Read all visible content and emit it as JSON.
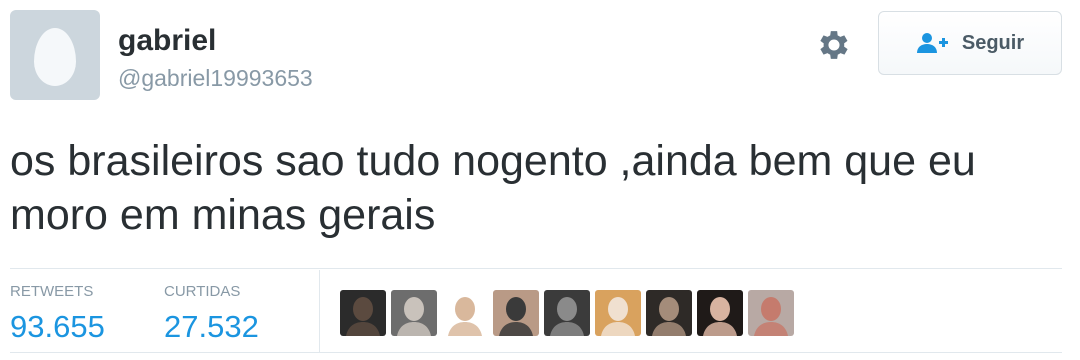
{
  "user": {
    "display_name": "gabriel",
    "handle": "@gabriel19993653",
    "avatar_icon": "egg-icon"
  },
  "actions": {
    "settings_icon": "gear-icon",
    "follow_label": "Seguir",
    "follow_icon": "add-user-icon"
  },
  "tweet": {
    "text": "os brasileiros sao tudo nogento ,ainda bem que eu moro em minas gerais"
  },
  "stats": {
    "retweets_label": "RETWEETS",
    "retweets_value": "93.655",
    "likes_label": "CURTIDAS",
    "likes_value": "27.532"
  },
  "likers": [
    {
      "name": "liker-1",
      "colors": [
        "#2b2b2b",
        "#5b4a3f"
      ]
    },
    {
      "name": "liker-2",
      "colors": [
        "#6d6d6d",
        "#c9c2bb"
      ]
    },
    {
      "name": "liker-3",
      "colors": [
        "#ffffff",
        "#d9b89c"
      ]
    },
    {
      "name": "liker-4",
      "colors": [
        "#b99a86",
        "#3a3a3a"
      ]
    },
    {
      "name": "liker-5",
      "colors": [
        "#3b3b3b",
        "#8a8a8a"
      ]
    },
    {
      "name": "liker-6",
      "colors": [
        "#d9a25e",
        "#f0e0d0"
      ]
    },
    {
      "name": "liker-7",
      "colors": [
        "#2e2a27",
        "#a48c7a"
      ]
    },
    {
      "name": "liker-8",
      "colors": [
        "#1f1a18",
        "#d8b3a0"
      ]
    },
    {
      "name": "liker-9",
      "colors": [
        "#b8a9a4",
        "#c57b6d"
      ]
    }
  ],
  "colors": {
    "accent": "#1b95e0",
    "muted": "#8899a6",
    "text": "#292f33"
  }
}
